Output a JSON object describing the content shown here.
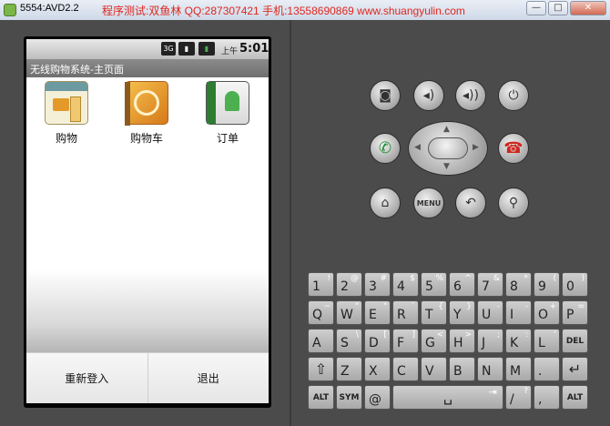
{
  "window": {
    "title": "5554:AVD2.2",
    "watermark": "程序测试:双鱼林 QQ:287307421 手机:13558690869 www.shuangyulin.com",
    "controls": [
      "—",
      "□",
      "✕"
    ]
  },
  "status_bar": {
    "network": "3G",
    "ampm": "上午",
    "time": "5:01"
  },
  "app": {
    "title": "无线购物系统-主页面",
    "grid": [
      {
        "label": "购物",
        "icon": "shop-icon"
      },
      {
        "label": "购物车",
        "icon": "cart-icon"
      },
      {
        "label": "订单",
        "icon": "order-icon"
      }
    ],
    "menu": [
      {
        "label": "重新登入"
      },
      {
        "label": "退出"
      }
    ]
  },
  "controls": {
    "menu_label": "MENU"
  },
  "keyboard": {
    "rows": [
      [
        {
          "m": "1",
          "s": "!"
        },
        {
          "m": "2",
          "s": "@"
        },
        {
          "m": "3",
          "s": "#"
        },
        {
          "m": "4",
          "s": "$"
        },
        {
          "m": "5",
          "s": "%"
        },
        {
          "m": "6",
          "s": "^"
        },
        {
          "m": "7",
          "s": "&"
        },
        {
          "m": "8",
          "s": "*"
        },
        {
          "m": "9",
          "s": "("
        },
        {
          "m": "0",
          "s": ")"
        }
      ],
      [
        {
          "m": "Q",
          "s": "~"
        },
        {
          "m": "W",
          "s": "\""
        },
        {
          "m": "E",
          "s": "\""
        },
        {
          "m": "R",
          "s": "`"
        },
        {
          "m": "T",
          "s": "{"
        },
        {
          "m": "Y",
          "s": "}"
        },
        {
          "m": "U",
          "s": "-"
        },
        {
          "m": "I",
          "s": "-"
        },
        {
          "m": "O",
          "s": "+"
        },
        {
          "m": "P",
          "s": "="
        }
      ],
      [
        {
          "m": "A",
          "s": ""
        },
        {
          "m": "S",
          "s": "\\"
        },
        {
          "m": "D",
          "s": "["
        },
        {
          "m": "F",
          "s": "]"
        },
        {
          "m": "G",
          "s": "<"
        },
        {
          "m": "H",
          "s": ">"
        },
        {
          "m": "J",
          "s": ";"
        },
        {
          "m": "K",
          "s": ":"
        },
        {
          "m": "L",
          "s": "'"
        }
      ],
      [
        {
          "m": "Z",
          "s": ""
        },
        {
          "m": "X",
          "s": ""
        },
        {
          "m": "C",
          "s": ""
        },
        {
          "m": "V",
          "s": ""
        },
        {
          "m": "B",
          "s": ""
        },
        {
          "m": "N",
          "s": ""
        },
        {
          "m": "M",
          "s": ""
        },
        {
          "m": ".",
          "s": ""
        }
      ],
      [
        {
          "m": "@",
          "s": ""
        },
        {
          "m": "/",
          "s": "?"
        },
        {
          "m": ",",
          "s": ""
        }
      ]
    ],
    "special": {
      "del_label": "DEL",
      "alt_label": "ALT",
      "sym_label": "SYM",
      "shift_glyph": "⇧",
      "enter_glyph": "↵",
      "space_glyph": "␣",
      "tab_glyph": "⇥"
    }
  }
}
